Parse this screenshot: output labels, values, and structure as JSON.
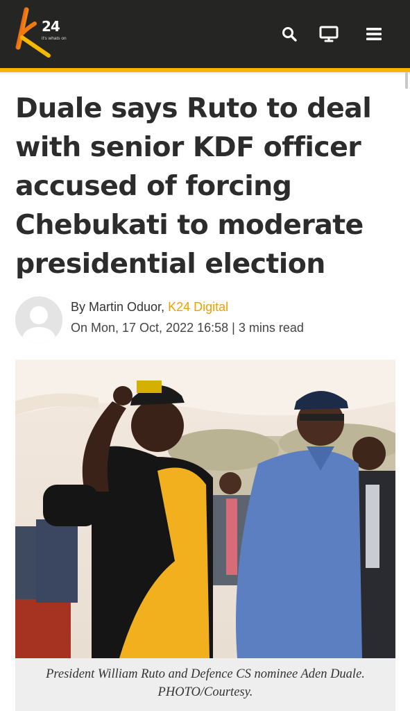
{
  "header": {
    "logo_number": "24",
    "logo_tagline": "it's whats on",
    "icons": [
      "search-icon",
      "tv-icon",
      "hamburger-menu-icon"
    ],
    "brand_accent": "#f5b800",
    "bar_color": "#252523"
  },
  "article": {
    "title": "Duale says Ruto to deal with senior KDF officer accused of forcing Chebukati to moderate presidential election",
    "byline_prefix": "By ",
    "author": "Martin Oduor",
    "separator": ", ",
    "source": "K24 Digital",
    "date_text": "On Mon, 17 Oct, 2022 16:58",
    "meta_divider": " | ",
    "read_time": "3 mins read",
    "photo_caption": "President William Ruto and Defence CS nominee Aden Duale. PHOTO/Courtesy."
  }
}
